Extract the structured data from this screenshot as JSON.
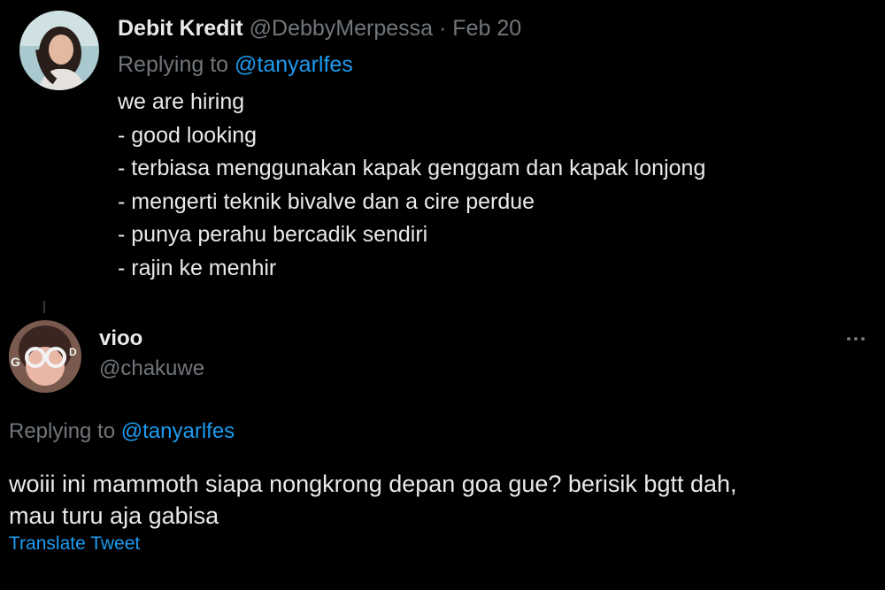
{
  "tweet1": {
    "display_name": "Debit Kredit",
    "handle": "@DebbyMerpessa",
    "separator": "·",
    "date": "Feb 20",
    "replying_prefix": "Replying to",
    "replying_handle": "@tanyarlfes",
    "lines": [
      "we are hiring",
      "- good looking",
      "- terbiasa menggunakan kapak genggam dan kapak lonjong",
      "- mengerti teknik bivalve dan a cire perdue",
      "- punya perahu bercadik sendiri",
      "- rajin ke menhir"
    ]
  },
  "tweet2": {
    "display_name": "vioo",
    "handle": "@chakuwe",
    "replying_prefix": "Replying to",
    "replying_handle": "@tanyarlfes",
    "body_line1": "woiii ini mammoth siapa nongkrong depan goa gue? berisik bgtt dah,",
    "body_line2": "mau turu aja gabisa",
    "translate_label": "Translate Tweet",
    "avatar_letters": [
      "G",
      "D"
    ]
  },
  "colors": {
    "background": "#000000",
    "text": "#e7e9ea",
    "muted": "#71767b",
    "link": "#1d9bf0"
  }
}
